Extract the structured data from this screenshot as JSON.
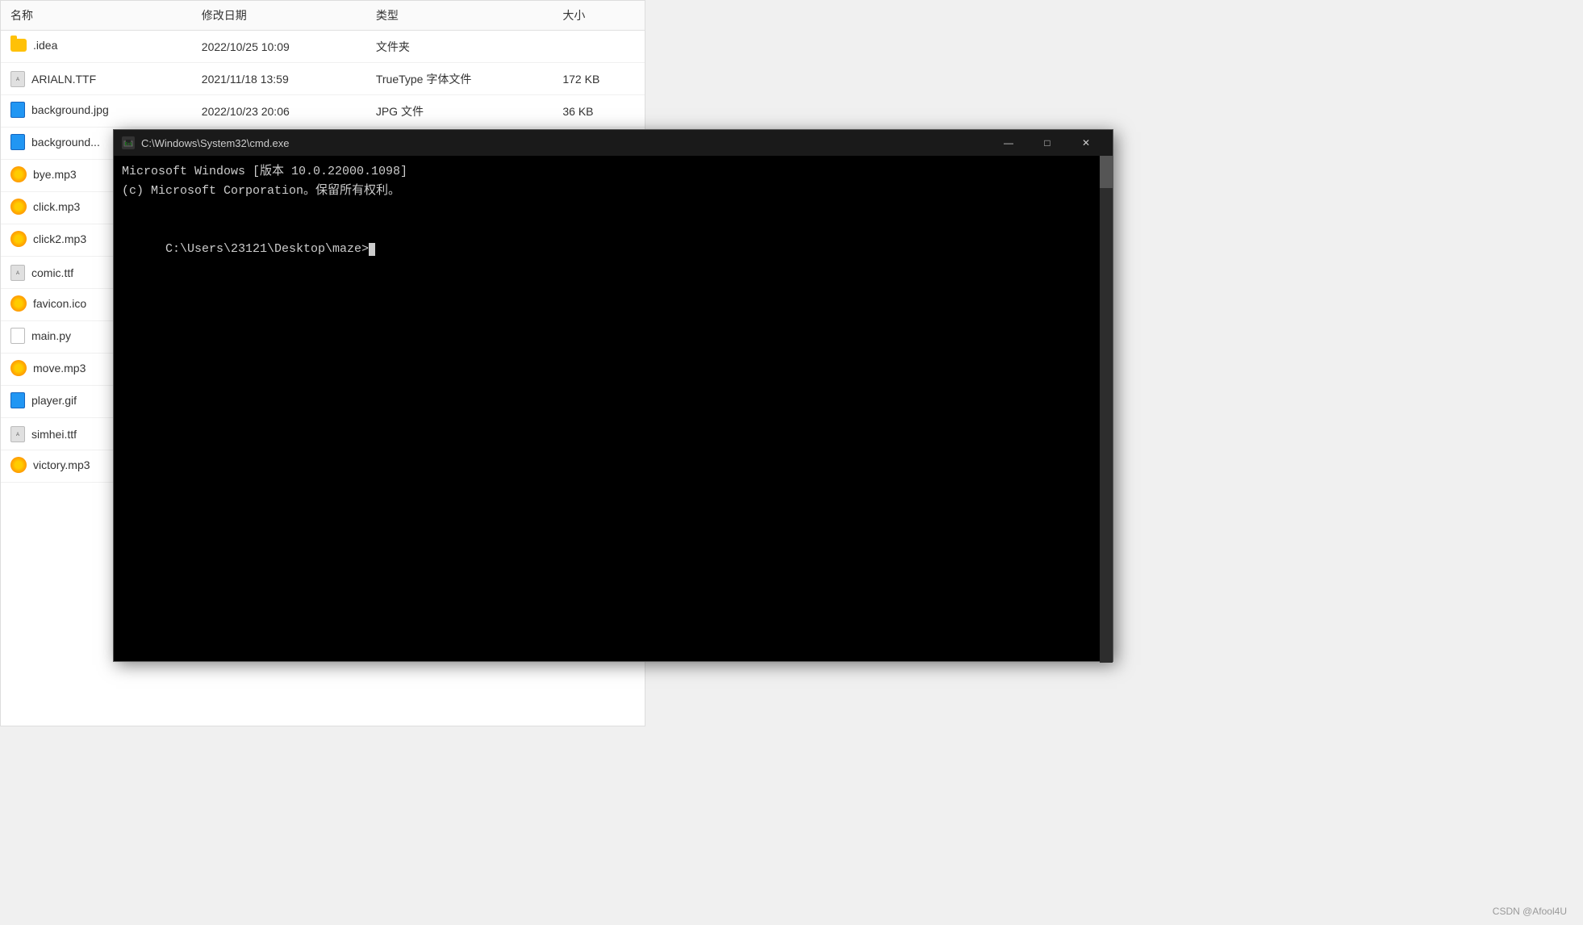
{
  "fileExplorer": {
    "columns": [
      "名称",
      "修改日期",
      "类型",
      "大小"
    ],
    "files": [
      {
        "name": ".idea",
        "date": "2022/10/25 10:09",
        "type": "文件夹",
        "size": "",
        "iconType": "folder"
      },
      {
        "name": "ARIALN.TTF",
        "date": "2021/11/18 13:59",
        "type": "TrueType 字体文件",
        "size": "172 KB",
        "iconType": "ttf"
      },
      {
        "name": "background.jpg",
        "date": "2022/10/23 20:06",
        "type": "JPG 文件",
        "size": "36 KB",
        "iconType": "jpg"
      },
      {
        "name": "background...",
        "date": "",
        "type": "",
        "size": "",
        "iconType": "jpg"
      },
      {
        "name": "bye.mp3",
        "date": "",
        "type": "",
        "size": "",
        "iconType": "mp3"
      },
      {
        "name": "click.mp3",
        "date": "",
        "type": "",
        "size": "",
        "iconType": "mp3"
      },
      {
        "name": "click2.mp3",
        "date": "",
        "type": "",
        "size": "",
        "iconType": "mp3"
      },
      {
        "name": "comic.ttf",
        "date": "",
        "type": "",
        "size": "",
        "iconType": "ttf"
      },
      {
        "name": "favicon.ico",
        "date": "",
        "type": "",
        "size": "",
        "iconType": "ico"
      },
      {
        "name": "main.py",
        "date": "",
        "type": "",
        "size": "",
        "iconType": "py"
      },
      {
        "name": "move.mp3",
        "date": "",
        "type": "",
        "size": "",
        "iconType": "mp3"
      },
      {
        "name": "player.gif",
        "date": "",
        "type": "",
        "size": "",
        "iconType": "gif"
      },
      {
        "name": "simhei.ttf",
        "date": "",
        "type": "",
        "size": "",
        "iconType": "ttf"
      },
      {
        "name": "victory.mp3",
        "date": "",
        "type": "",
        "size": "",
        "iconType": "mp3"
      }
    ]
  },
  "cmdWindow": {
    "title": "C:\\Windows\\System32\\cmd.exe",
    "line1": "Microsoft Windows [版本 10.0.22000.1098]",
    "line2": "(c) Microsoft Corporation。保留所有权利。",
    "line3": "",
    "prompt": "C:\\Users\\23121\\Desktop\\maze>",
    "minimizeLabel": "—",
    "maximizeLabel": "□",
    "closeLabel": "✕"
  },
  "watermark": {
    "text": "CSDN @Afool4U"
  }
}
